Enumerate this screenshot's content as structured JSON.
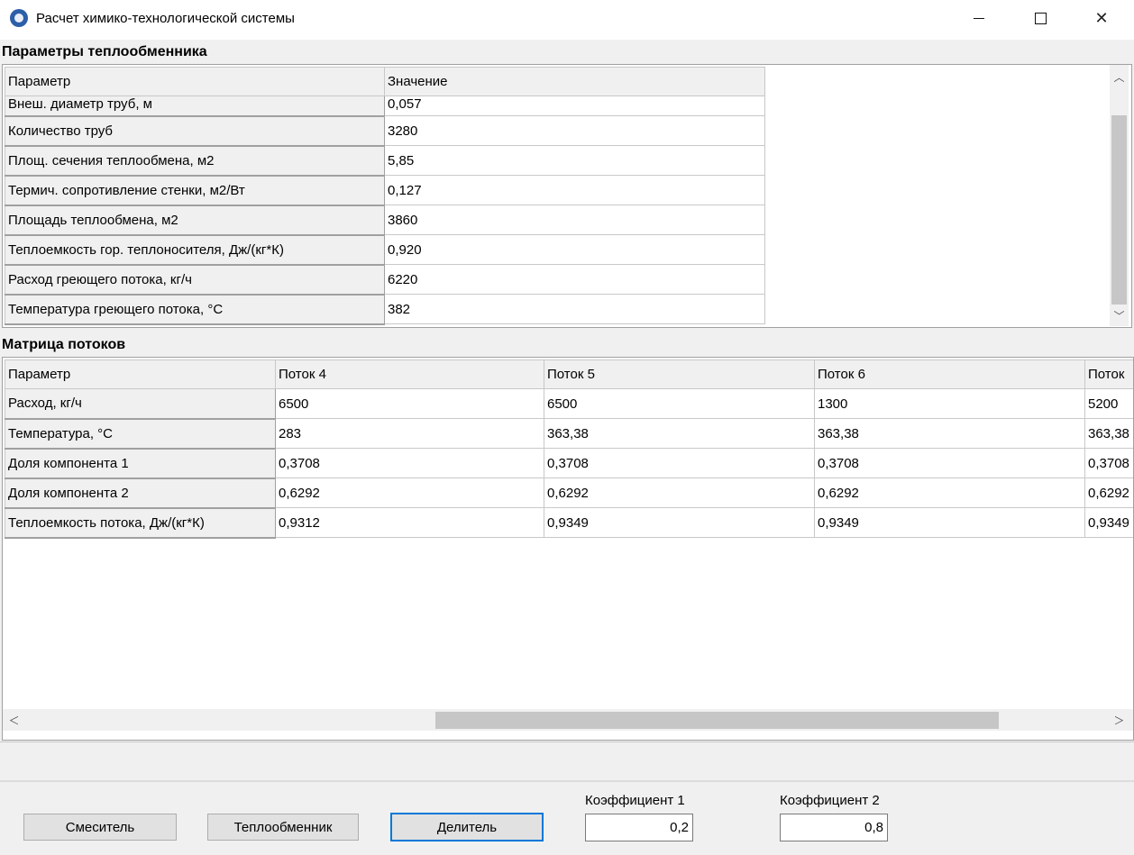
{
  "window": {
    "title": "Расчет химико-технологической системы"
  },
  "heat_exchanger": {
    "section_title": "Параметры теплообменника",
    "columns": [
      "Параметр",
      "Значение"
    ],
    "rows": [
      {
        "param": "Внеш. диаметр труб, м",
        "value": "0,057"
      },
      {
        "param": "Количество труб",
        "value": "3280"
      },
      {
        "param": "Площ. сечения теплообмена, м2",
        "value": "5,85"
      },
      {
        "param": "Термич. сопротивление стенки, м2/Вт",
        "value": "0,127"
      },
      {
        "param": "Площадь теплообмена, м2",
        "value": "3860"
      },
      {
        "param": "Теплоемкость гор. теплоносителя, Дж/(кг*К)",
        "value": "0,920"
      },
      {
        "param": "Расход греющего потока, кг/ч",
        "value": "6220"
      },
      {
        "param": "Температура греющего потока, °С",
        "value": "382"
      }
    ]
  },
  "flow_matrix": {
    "section_title": "Матрица потоков",
    "columns": [
      "Параметр",
      "Поток 4",
      "Поток 5",
      "Поток 6",
      "Поток"
    ],
    "rows": [
      {
        "param": "Расход, кг/ч",
        "values": [
          "6500",
          "6500",
          "1300",
          "5200"
        ]
      },
      {
        "param": "Температура, °С",
        "values": [
          "283",
          "363,38",
          "363,38",
          "363,38"
        ]
      },
      {
        "param": "Доля компонента 1",
        "values": [
          "0,3708",
          "0,3708",
          "0,3708",
          "0,3708"
        ]
      },
      {
        "param": "Доля компонента 2",
        "values": [
          "0,6292",
          "0,6292",
          "0,6292",
          "0,6292"
        ]
      },
      {
        "param": "Теплоемкость потока, Дж/(кг*К)",
        "values": [
          "0,9312",
          "0,9349",
          "0,9349",
          "0,9349"
        ]
      }
    ]
  },
  "buttons": {
    "mixer": "Смеситель",
    "heat_exchanger": "Теплообменник",
    "splitter": "Делитель"
  },
  "coefficients": {
    "coef1_label": "Коэффициент 1",
    "coef1_value": "0,2",
    "coef2_label": "Коэффициент 2",
    "coef2_value": "0,8"
  },
  "icons": {
    "app": "app-paw-icon",
    "scroll_up": "scroll-up-icon",
    "scroll_down": "scroll-down-icon",
    "scroll_left": "scroll-left-icon",
    "scroll_right": "scroll-right-icon"
  }
}
